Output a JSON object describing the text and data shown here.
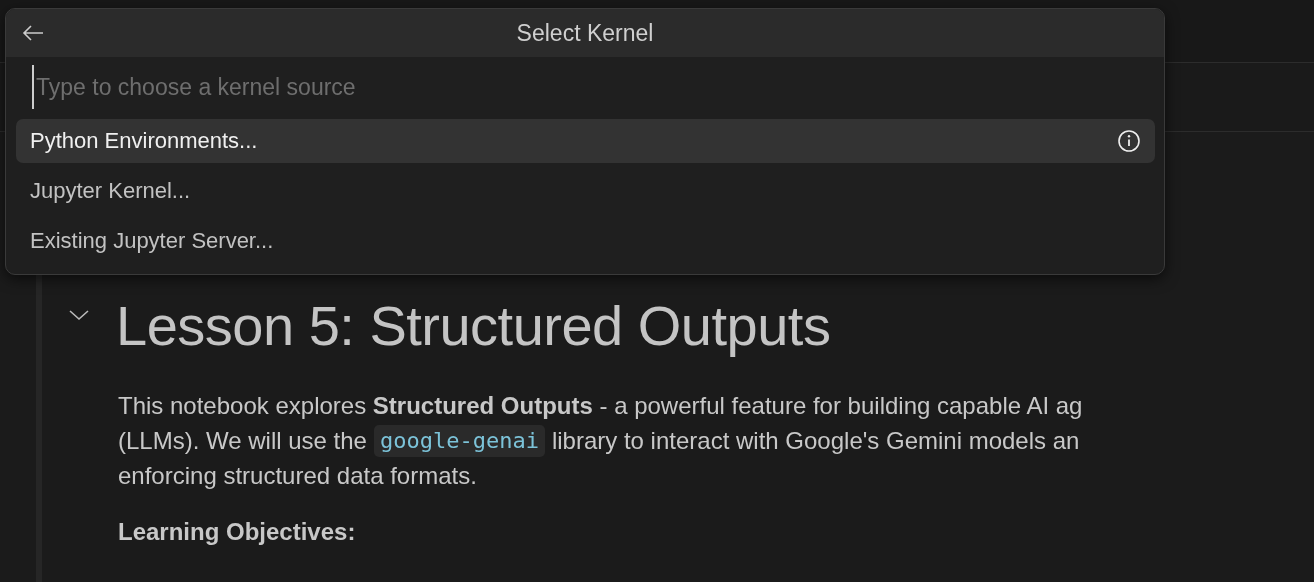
{
  "quick_pick": {
    "title": "Select Kernel",
    "search": {
      "placeholder": "Type to choose a kernel source"
    },
    "items": [
      {
        "label": "Python Environments...",
        "selected": true
      },
      {
        "label": "Jupyter Kernel...",
        "selected": false
      },
      {
        "label": "Existing Jupyter Server...",
        "selected": false
      }
    ]
  },
  "cell": {
    "expanded": true,
    "heading": "Lesson 5: Structured Outputs",
    "paragraph": {
      "line_1": "This notebook explores **Structured Outputs** - a powerful feature for building capable AI ag",
      "line_2_before": "(LLMs). We will use the",
      "code": "google-genai",
      "line_2_after": "library to interact with Google's Gemini models an",
      "line_3": "enforcing structured data formats."
    },
    "subheading": "Learning Objectives:"
  }
}
